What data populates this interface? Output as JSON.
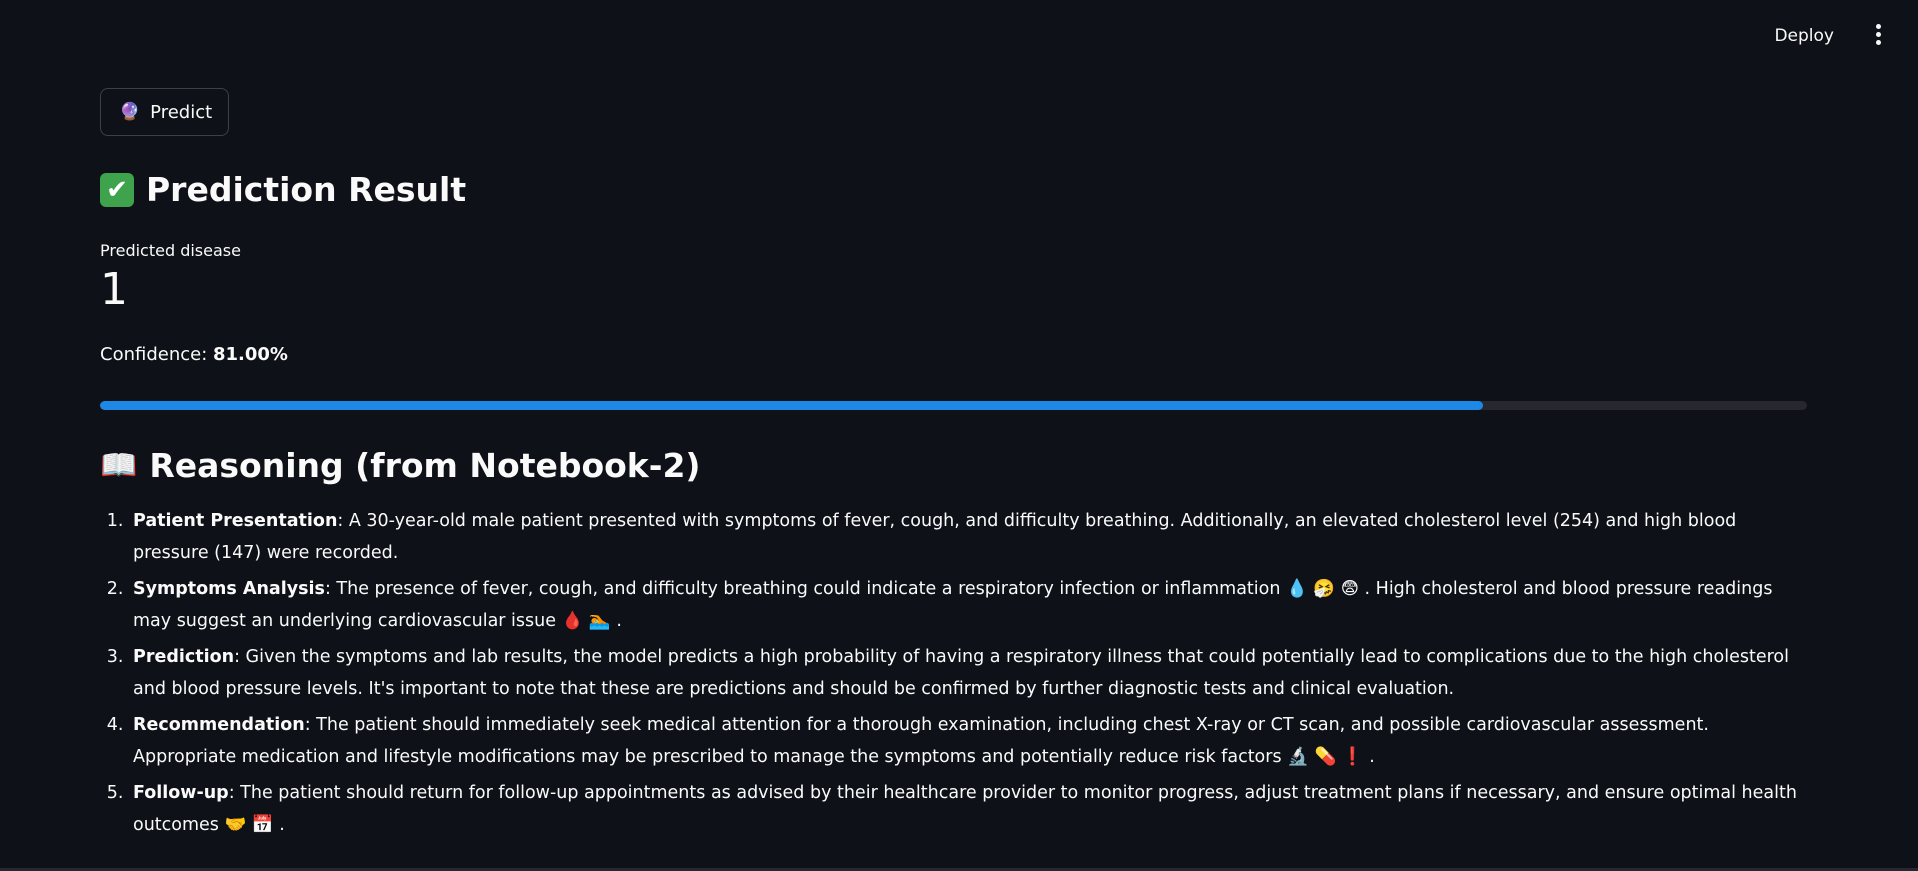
{
  "header": {
    "deploy_label": "Deploy",
    "menu_icon": "kebab-menu-icon"
  },
  "predict_button": {
    "icon": "🔮",
    "label": "Predict"
  },
  "result": {
    "title_icon": "✅",
    "title": "Prediction Result",
    "metric_label": "Predicted disease",
    "metric_value": "1",
    "confidence_prefix": "Confidence: ",
    "confidence_value": "81.00%",
    "progress_fraction": 0.81,
    "progress_color": "#1e88e5"
  },
  "reasoning": {
    "title_icon": "📖",
    "title": "Reasoning (from Notebook-2)",
    "items": [
      {
        "heading": "Patient Presentation",
        "text": ": A 30-year-old male patient presented with symptoms of fever, cough, and difficulty breathing. Additionally, an elevated cholesterol level (254) and high blood pressure (147) were recorded.",
        "emojis": ""
      },
      {
        "heading": "Symptoms Analysis",
        "text": ": The presence of fever, cough, and difficulty breathing could indicate a respiratory infection or inflammation 💧 🤧 😨 . High cholesterol and blood pressure readings may suggest an underlying cardiovascular issue 🩸 🏊",
        "emojis": "."
      },
      {
        "heading": "Prediction",
        "text": ": Given the symptoms and lab results, the model predicts a high probability of having a respiratory illness that could potentially lead to complications due to the high cholesterol and blood pressure levels. It's important to note that these are predictions and should be confirmed by further diagnostic tests and clinical evaluation.",
        "emojis": ""
      },
      {
        "heading": "Recommendation",
        "text": ": The patient should immediately seek medical attention for a thorough examination, including chest X-ray or CT scan, and possible cardiovascular assessment. Appropriate medication and lifestyle modifications may be prescribed to manage the symptoms and potentially reduce risk factors 🔬 💊 ❗",
        "emojis": "."
      },
      {
        "heading": "Follow-up",
        "text": ": The patient should return for follow-up appointments as advised by their healthcare provider to monitor progress, adjust treatment plans if necessary, and ensure optimal health outcomes 🤝 📅",
        "emojis": "."
      }
    ]
  }
}
